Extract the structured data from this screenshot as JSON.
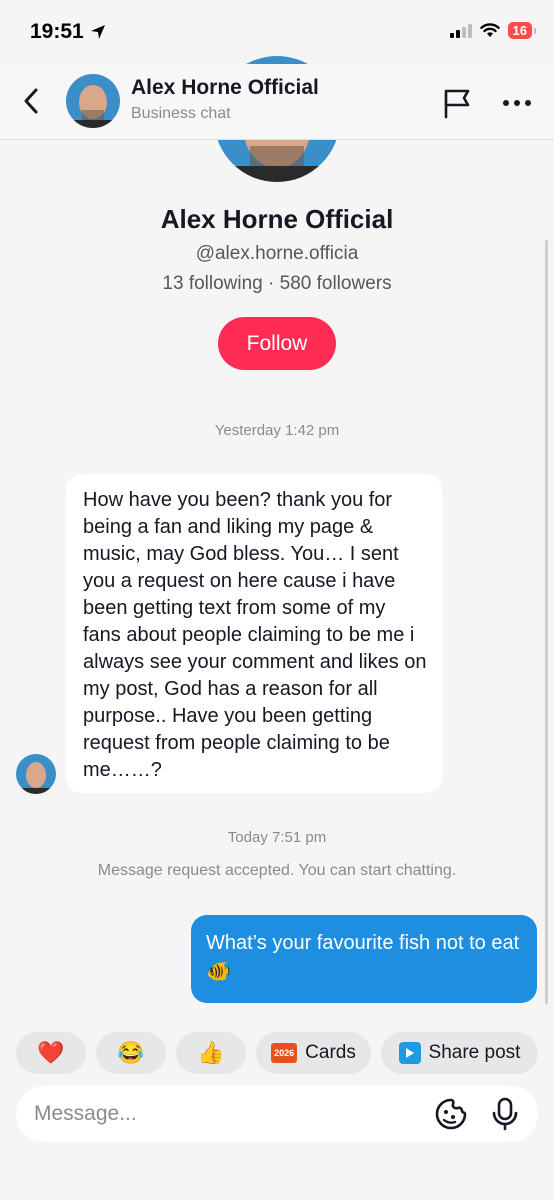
{
  "status_bar": {
    "time": "19:51",
    "battery": "16"
  },
  "header": {
    "name": "Alex Horne Official",
    "subtitle": "Business chat"
  },
  "profile": {
    "name": "Alex Horne Official",
    "handle": "@alex.horne.officia",
    "stats": "13 following · 580 followers",
    "follow_label": "Follow"
  },
  "messages": {
    "timestamp_1": "Yesterday 1:42 pm",
    "incoming_text": "How have you been? thank you for being a fan and liking my page & music, may God bless. You… I sent you a request on here cause i have been getting text from some of my fans about people claiming to be me i always see your comment and likes on my post, God has a reason for all purpose.. Have you been getting request from people claiming to be me……?",
    "timestamp_2": "Today 7:51 pm",
    "system_text": "Message request accepted. You can start chatting.",
    "outgoing_text": "What’s your favourite fish not to eat 🐠"
  },
  "quick_replies": {
    "heart": "❤️",
    "laugh": "😂",
    "thumbs": "👍",
    "cards_icon_text": "2026",
    "cards_label": "Cards",
    "share_label": "Share post"
  },
  "composer": {
    "placeholder": "Message..."
  },
  "colors": {
    "accent_pink": "#fe2c55",
    "outgoing_blue": "#1d8ee0"
  }
}
